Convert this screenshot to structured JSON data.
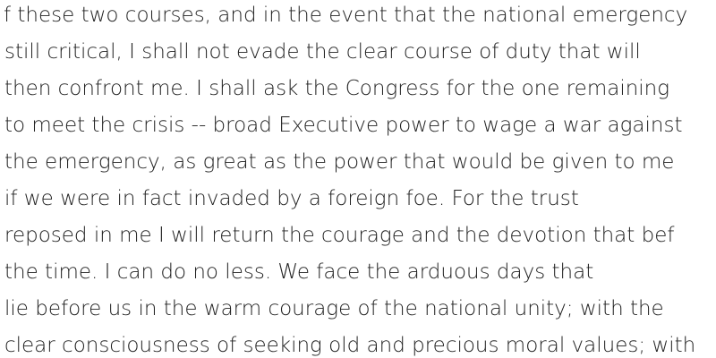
{
  "document": {
    "lines": [
      "f these two courses, and in the event that the national emergency",
      "still critical, I shall not evade the clear course of duty that will",
      "then confront me. I shall ask the Congress for the one remaining",
      "to meet the crisis -- broad Executive power to wage a war against",
      "the emergency, as great as the power that would be given to me",
      "if we were in fact invaded by a foreign foe. For the trust",
      "reposed in me I will return the courage and the devotion that bef",
      "the time. I can do no less. We face the arduous days that",
      "lie before us in the warm courage of the national unity; with the",
      "clear consciousness of seeking old and precious moral values; with"
    ]
  }
}
